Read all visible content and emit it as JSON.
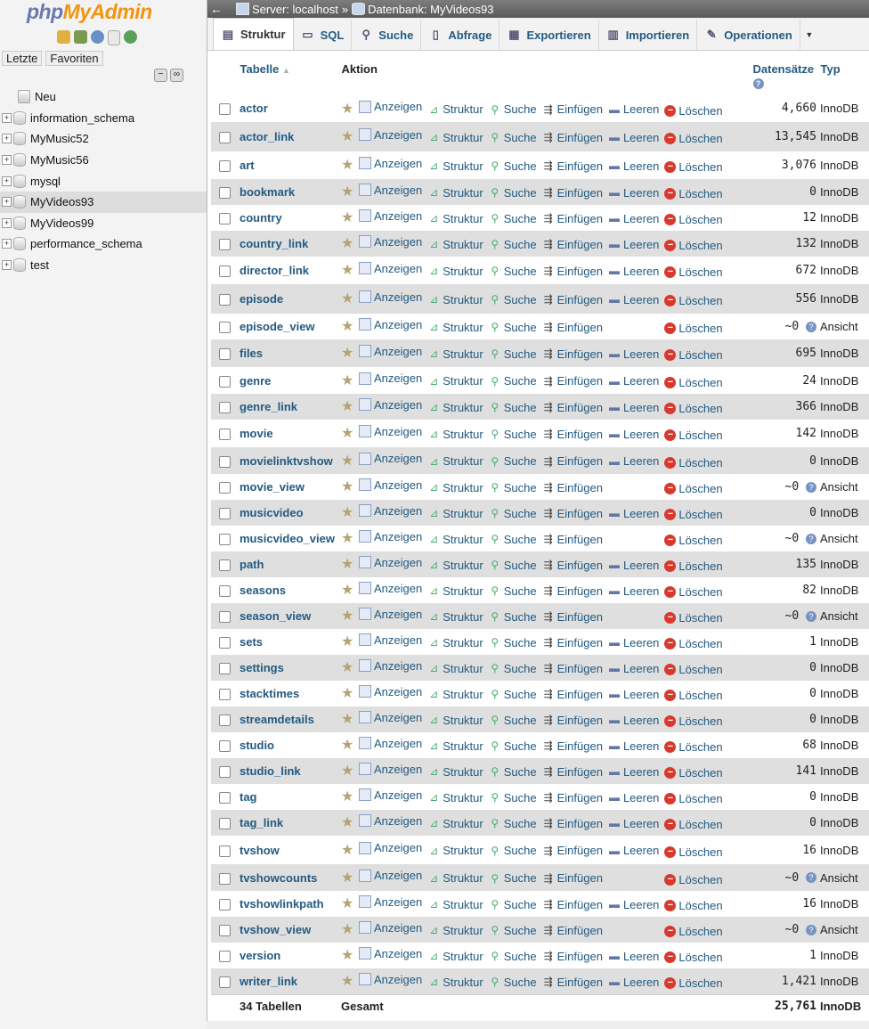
{
  "logo": {
    "part1": "php",
    "part2": "MyAdmin"
  },
  "nav": {
    "recent_tab": "Letzte",
    "favorites_tab": "Favoriten",
    "new_label": "Neu",
    "databases": [
      {
        "name": "information_schema",
        "selected": false
      },
      {
        "name": "MyMusic52",
        "selected": false
      },
      {
        "name": "MyMusic56",
        "selected": false
      },
      {
        "name": "mysql",
        "selected": false
      },
      {
        "name": "MyVideos93",
        "selected": true
      },
      {
        "name": "MyVideos99",
        "selected": false
      },
      {
        "name": "performance_schema",
        "selected": false
      },
      {
        "name": "test",
        "selected": false
      }
    ]
  },
  "breadcrumb": {
    "back": "←",
    "server": "Server: localhost",
    "sep": "»",
    "database": "Datenbank: MyVideos93"
  },
  "tabs": [
    {
      "label": "Struktur",
      "icon": "structure-icon",
      "active": true
    },
    {
      "label": "SQL",
      "icon": "sql-icon",
      "active": false
    },
    {
      "label": "Suche",
      "icon": "search-icon",
      "active": false
    },
    {
      "label": "Abfrage",
      "icon": "query-icon",
      "active": false
    },
    {
      "label": "Exportieren",
      "icon": "export-icon",
      "active": false
    },
    {
      "label": "Importieren",
      "icon": "import-icon",
      "active": false
    },
    {
      "label": "Operationen",
      "icon": "operations-icon",
      "active": false
    }
  ],
  "table": {
    "headers": {
      "table": "Tabelle",
      "action": "Aktion",
      "rows": "Datensätze",
      "type": "Typ"
    },
    "actions": {
      "browse": "Anzeigen",
      "structure": "Struktur",
      "search": "Suche",
      "insert": "Einfügen",
      "empty": "Leeren",
      "drop": "Löschen"
    },
    "rows": [
      {
        "name": "actor",
        "records": "4,660",
        "type": "InnoDB",
        "empty": true,
        "view": false
      },
      {
        "name": "actor_link",
        "records": "13,545",
        "type": "InnoDB",
        "empty": true,
        "view": false
      },
      {
        "name": "art",
        "records": "3,076",
        "type": "InnoDB",
        "empty": true,
        "view": false
      },
      {
        "name": "bookmark",
        "records": "0",
        "type": "InnoDB",
        "empty": true,
        "view": false
      },
      {
        "name": "country",
        "records": "12",
        "type": "InnoDB",
        "empty": true,
        "view": false
      },
      {
        "name": "country_link",
        "records": "132",
        "type": "InnoDB",
        "empty": true,
        "view": false
      },
      {
        "name": "director_link",
        "records": "672",
        "type": "InnoDB",
        "empty": true,
        "view": false
      },
      {
        "name": "episode",
        "records": "556",
        "type": "InnoDB",
        "empty": true,
        "view": false
      },
      {
        "name": "episode_view",
        "records": "~0",
        "type": "Ansicht",
        "empty": false,
        "view": true
      },
      {
        "name": "files",
        "records": "695",
        "type": "InnoDB",
        "empty": true,
        "view": false
      },
      {
        "name": "genre",
        "records": "24",
        "type": "InnoDB",
        "empty": true,
        "view": false
      },
      {
        "name": "genre_link",
        "records": "366",
        "type": "InnoDB",
        "empty": true,
        "view": false
      },
      {
        "name": "movie",
        "records": "142",
        "type": "InnoDB",
        "empty": true,
        "view": false
      },
      {
        "name": "movielinktvshow",
        "records": "0",
        "type": "InnoDB",
        "empty": true,
        "view": false
      },
      {
        "name": "movie_view",
        "records": "~0",
        "type": "Ansicht",
        "empty": false,
        "view": true
      },
      {
        "name": "musicvideo",
        "records": "0",
        "type": "InnoDB",
        "empty": true,
        "view": false
      },
      {
        "name": "musicvideo_view",
        "records": "~0",
        "type": "Ansicht",
        "empty": false,
        "view": true
      },
      {
        "name": "path",
        "records": "135",
        "type": "InnoDB",
        "empty": true,
        "view": false
      },
      {
        "name": "seasons",
        "records": "82",
        "type": "InnoDB",
        "empty": true,
        "view": false
      },
      {
        "name": "season_view",
        "records": "~0",
        "type": "Ansicht",
        "empty": false,
        "view": true
      },
      {
        "name": "sets",
        "records": "1",
        "type": "InnoDB",
        "empty": true,
        "view": false
      },
      {
        "name": "settings",
        "records": "0",
        "type": "InnoDB",
        "empty": true,
        "view": false
      },
      {
        "name": "stacktimes",
        "records": "0",
        "type": "InnoDB",
        "empty": true,
        "view": false
      },
      {
        "name": "streamdetails",
        "records": "0",
        "type": "InnoDB",
        "empty": true,
        "view": false
      },
      {
        "name": "studio",
        "records": "68",
        "type": "InnoDB",
        "empty": true,
        "view": false
      },
      {
        "name": "studio_link",
        "records": "141",
        "type": "InnoDB",
        "empty": true,
        "view": false
      },
      {
        "name": "tag",
        "records": "0",
        "type": "InnoDB",
        "empty": true,
        "view": false
      },
      {
        "name": "tag_link",
        "records": "0",
        "type": "InnoDB",
        "empty": true,
        "view": false
      },
      {
        "name": "tvshow",
        "records": "16",
        "type": "InnoDB",
        "empty": true,
        "view": false
      },
      {
        "name": "tvshowcounts",
        "records": "~0",
        "type": "Ansicht",
        "empty": false,
        "view": true
      },
      {
        "name": "tvshowlinkpath",
        "records": "16",
        "type": "InnoDB",
        "empty": true,
        "view": false
      },
      {
        "name": "tvshow_view",
        "records": "~0",
        "type": "Ansicht",
        "empty": false,
        "view": true
      },
      {
        "name": "version",
        "records": "1",
        "type": "InnoDB",
        "empty": true,
        "view": false
      },
      {
        "name": "writer_link",
        "records": "1,421",
        "type": "InnoDB",
        "empty": true,
        "view": false
      }
    ],
    "footer": {
      "count": "34 Tabellen",
      "total_label": "Gesamt",
      "total_records": "25,761",
      "total_type": "InnoDB"
    }
  }
}
